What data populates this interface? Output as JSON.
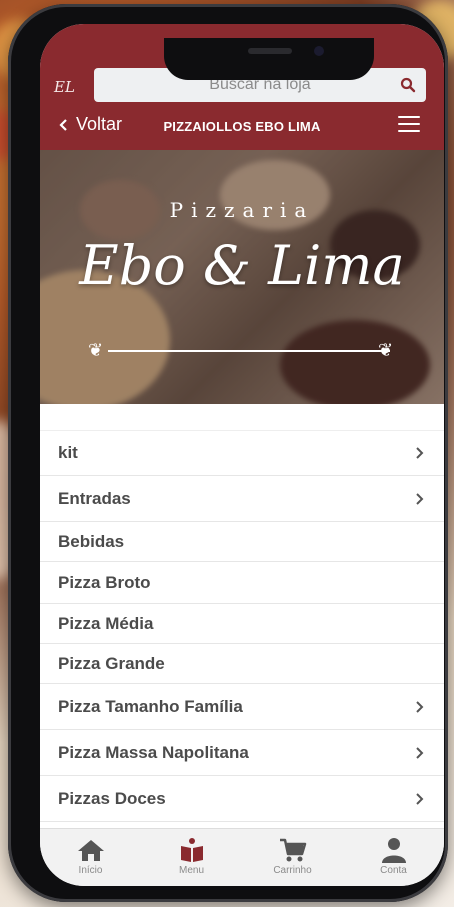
{
  "store": {
    "logo": "EL",
    "title": "PIZZAIOLLOS EBO LIMA"
  },
  "search": {
    "placeholder": "Buscar na loja"
  },
  "nav": {
    "back_label": "Voltar"
  },
  "hero": {
    "small": "Pizzaria",
    "big": "Ebo & Lima"
  },
  "menu": {
    "items": [
      {
        "label": "kit",
        "chevron": true
      },
      {
        "label": "Entradas",
        "chevron": true
      },
      {
        "label": "Bebidas",
        "chevron": false
      },
      {
        "label": "Pizza Broto",
        "chevron": false
      },
      {
        "label": "Pizza Média",
        "chevron": false
      },
      {
        "label": "Pizza Grande",
        "chevron": false
      },
      {
        "label": "Pizza Tamanho Família",
        "chevron": true
      },
      {
        "label": "Pizza Massa Napolitana",
        "chevron": true
      },
      {
        "label": "Pizzas Doces",
        "chevron": true
      }
    ]
  },
  "bottom_nav": [
    {
      "label": "Início",
      "icon": "home-icon"
    },
    {
      "label": "Menu",
      "icon": "menu-book-icon",
      "active": true
    },
    {
      "label": "Carrinho",
      "icon": "cart-icon"
    },
    {
      "label": "Conta",
      "icon": "user-icon"
    }
  ],
  "colors": {
    "brand": "#8a2a2f",
    "menu_text": "#4b4b4b"
  }
}
